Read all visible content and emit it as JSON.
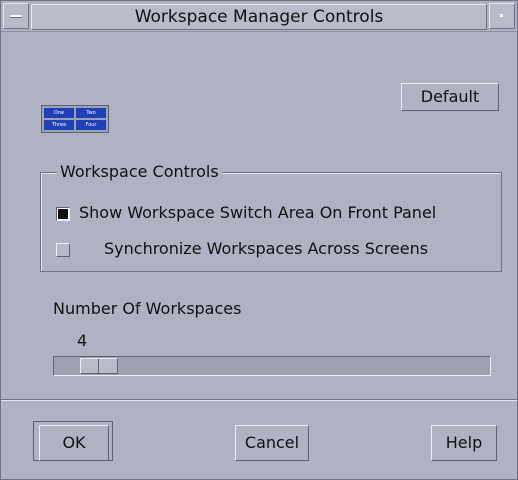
{
  "window": {
    "title": "Workspace Manager Controls"
  },
  "icons": {
    "window_menu": "window-menu-icon",
    "window_right": "window-control-icon",
    "workspaces": "workspace-switch-icon"
  },
  "preview": {
    "labels": [
      "One",
      "Two",
      "Three",
      "Four"
    ]
  },
  "buttons": {
    "default": "Default",
    "ok": "OK",
    "cancel": "Cancel",
    "help": "Help"
  },
  "workspace_controls": {
    "title": "Workspace Controls",
    "show_switch": {
      "label": "Show Workspace Switch Area On Front Panel",
      "checked": true
    },
    "synchronize": {
      "label": "Synchronize Workspaces Across Screens",
      "checked": false
    }
  },
  "number_of_workspaces": {
    "label": "Number Of Workspaces",
    "value": "4"
  },
  "colors": {
    "dialog_bg": "#aeb2c3",
    "workspace_tile": "#2040b8",
    "checkbox_on": "#111111"
  }
}
